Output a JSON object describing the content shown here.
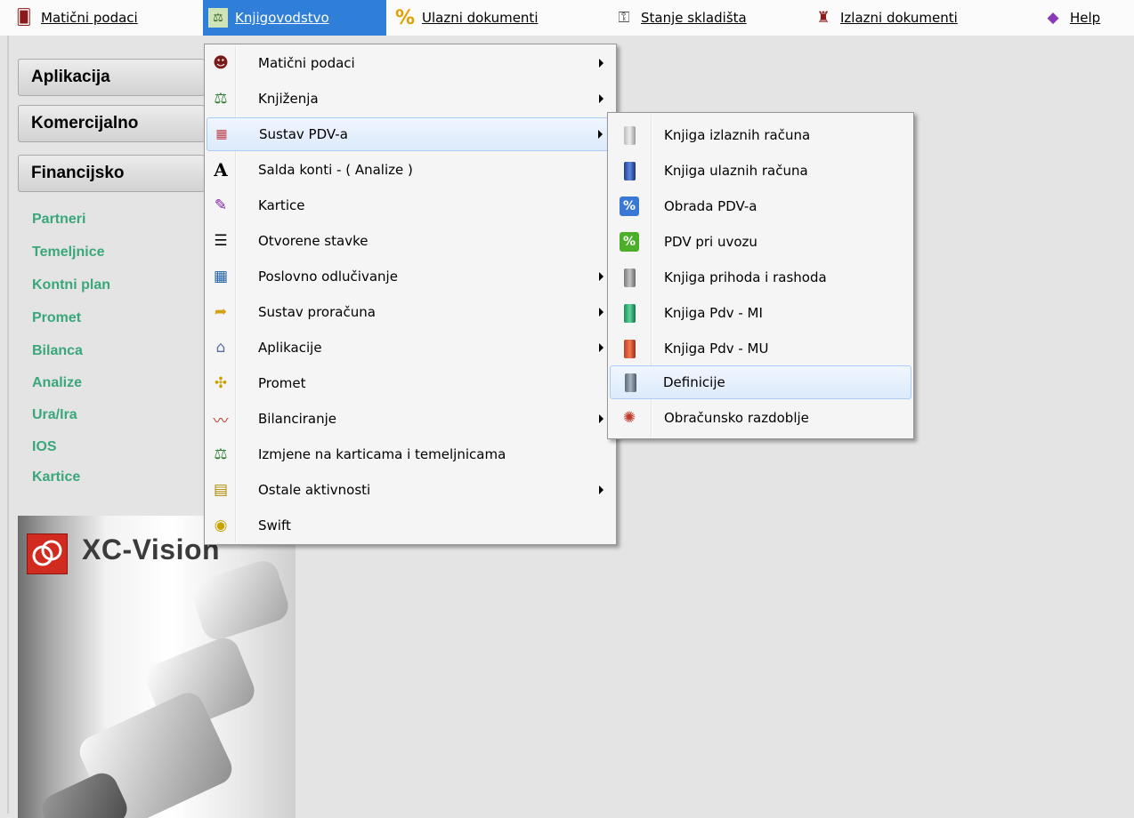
{
  "menubar": {
    "items": [
      {
        "label": "Matični podaci",
        "icon": "person-icon"
      },
      {
        "label": "Knjigovodstvo",
        "icon": "scales-icon"
      },
      {
        "label": "Ulazni dokumenti",
        "icon": "percent-icon"
      },
      {
        "label": "Stanje skladišta",
        "icon": "keys-icon"
      },
      {
        "label": "Izlazni dokumenti",
        "icon": "stamp-icon"
      },
      {
        "label": "Help",
        "icon": "help-book-icon"
      }
    ]
  },
  "sidebar": {
    "sections": [
      "Aplikacija",
      "Komercijalno",
      "Financijsko"
    ],
    "links": [
      "Partneri",
      "Temeljnice",
      "Kontni plan",
      "Promet",
      "Bilanca",
      "Analize",
      "Ura/Ira",
      "IOS",
      "Kartice"
    ],
    "link_color": "#3aa77b"
  },
  "logo": {
    "text": "XC-Vision",
    "brand_color": "#d12a1f"
  },
  "knjigovodstvo_menu": {
    "items": [
      {
        "label": "Matični podaci",
        "submenu": true
      },
      {
        "label": "Knjiženja",
        "submenu": true
      },
      {
        "label": "Sustav PDV-a",
        "submenu": true,
        "highlighted": true
      },
      {
        "label": "Salda konti - ( Analize )",
        "submenu": false
      },
      {
        "label": "Kartice",
        "submenu": false
      },
      {
        "label": "Otvorene stavke",
        "submenu": false
      },
      {
        "label": "Poslovno odlučivanje",
        "submenu": true
      },
      {
        "label": "Sustav proračuna",
        "submenu": true
      },
      {
        "label": "Aplikacije",
        "submenu": true
      },
      {
        "label": "Promet",
        "submenu": false
      },
      {
        "label": "Bilanciranje",
        "submenu": true
      },
      {
        "label": "Izmjene na karticama i temeljnicama",
        "submenu": false
      },
      {
        "label": "Ostale aktivnosti",
        "submenu": true
      },
      {
        "label": "Swift",
        "submenu": false
      }
    ]
  },
  "pdv_submenu": {
    "items": [
      {
        "label": "Knjiga izlaznih računa",
        "icon": "book-gray-icon"
      },
      {
        "label": "Knjiga ulaznih računa",
        "icon": "book-blue-icon"
      },
      {
        "label": "Obrada PDV-a",
        "icon": "percent-blue-icon"
      },
      {
        "label": "PDV pri uvozu",
        "icon": "percent-green-icon"
      },
      {
        "label": "Knjiga prihoda i rashoda",
        "icon": "book-gray-icon"
      },
      {
        "label": "Knjiga Pdv - MI",
        "icon": "book-green-icon"
      },
      {
        "label": "Knjiga Pdv - MU",
        "icon": "book-red-icon"
      },
      {
        "label": "Definicije",
        "icon": "book-gray-icon",
        "highlighted": true
      },
      {
        "label": "Obračunsko razdoblje",
        "icon": "calendar-icon"
      }
    ]
  },
  "colors": {
    "menubar_active": "#2f7fd8",
    "highlight_border": "#a9cdf7"
  }
}
